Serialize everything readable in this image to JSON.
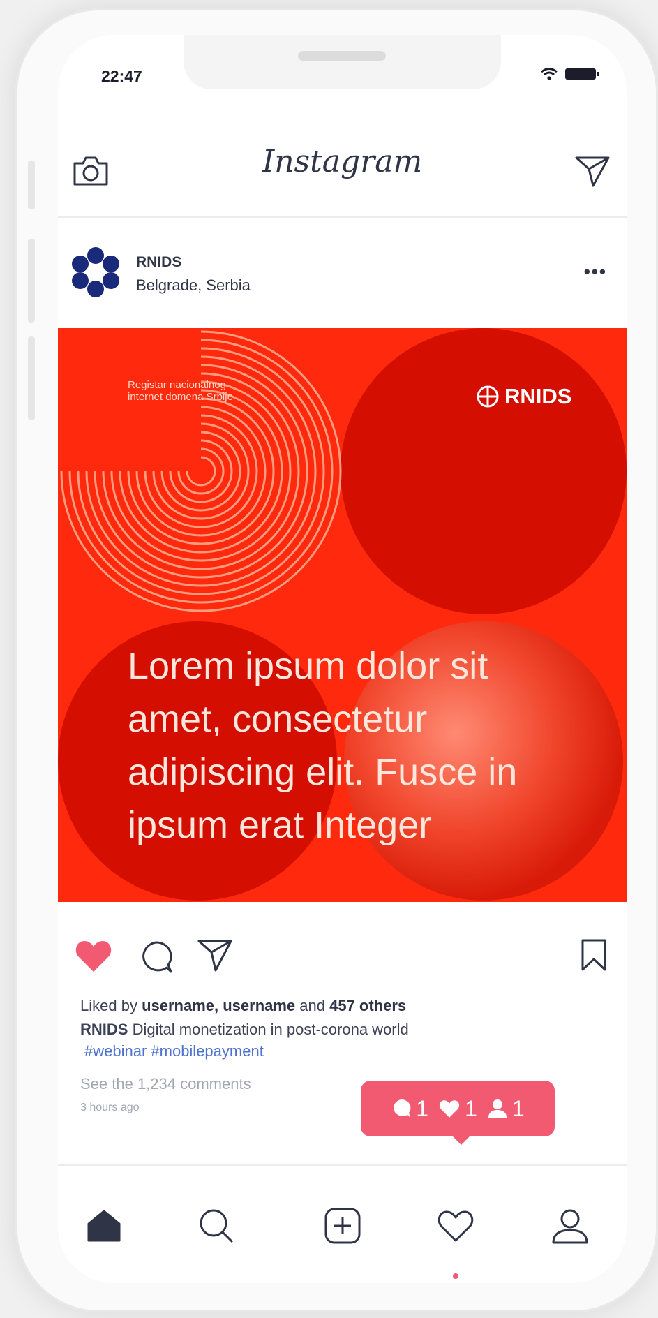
{
  "status": {
    "time": "22:47"
  },
  "header": {
    "title": "Instagram"
  },
  "post": {
    "username": "RNIDS",
    "location": "Belgrade, Serbia",
    "image": {
      "registar_line1": "Registar nacionalnog",
      "registar_line2": "internet domena Srbije",
      "brand": "RNIDS",
      "headline": "Lorem ipsum dolor sit amet, consectetur adipiscing elit. Fusce in ipsum erat Integer"
    },
    "likes": {
      "prefix": "Liked by ",
      "users": "username, username",
      "middle": " and ",
      "others": "457 others"
    },
    "caption": {
      "user": "RNIDS",
      "text": " Digital monetization in post-corona world"
    },
    "tags": "#webinar #mobilepayment",
    "comments_link": "See the 1,234 comments",
    "time_ago": "3 hours ago"
  },
  "notification": {
    "comments": "1",
    "likes": "1",
    "followers": "1"
  },
  "colors": {
    "accent": "#f25a72",
    "image_bg": "#ff2a0e",
    "text": "#2f3447",
    "link": "#4e72d0"
  },
  "icons": [
    "camera-icon",
    "send-icon",
    "more-icon",
    "heart-icon",
    "comment-icon",
    "share-icon",
    "bookmark-icon",
    "home-icon",
    "search-icon",
    "add-icon",
    "activity-icon",
    "profile-icon"
  ]
}
